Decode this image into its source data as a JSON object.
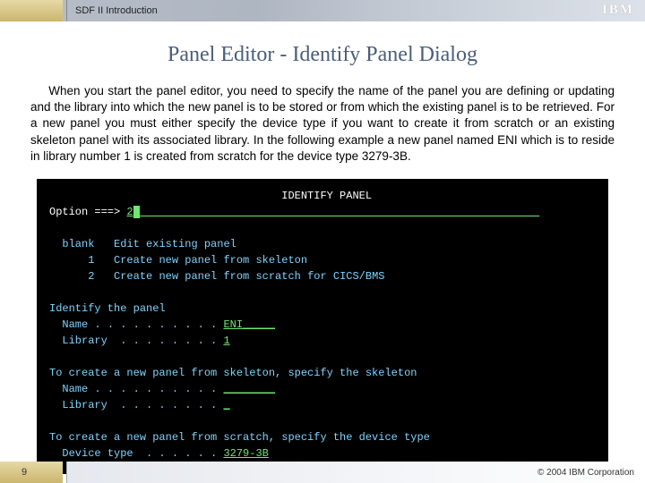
{
  "header": {
    "product": "SDF II  Introduction",
    "logo": "IBM"
  },
  "title": "Panel Editor - Identify Panel Dialog",
  "paragraph": "When you start the panel editor, you need to specify the name of the panel you are defining or updating and the library into which the new panel is to be stored or from which the existing panel is to be retrieved. For a new panel you must either specify the device type if you want to create it from scratch or an existing skeleton panel with its associated library. In the following example a new panel named ENI which is to reside in library number 1 is created from scratch for the  device type 3279-3B.",
  "terminal": {
    "heading": "IDENTIFY PANEL",
    "option_prompt": "Option ===>",
    "option_value": "2",
    "options": {
      "blank": {
        "key": "blank",
        "desc": "Edit existing panel"
      },
      "one": {
        "key": "1",
        "desc": "Create new panel from skeleton"
      },
      "two": {
        "key": "2",
        "desc": "Create new panel from scratch for CICS/BMS"
      }
    },
    "identify": {
      "label": "Identify the panel",
      "name_label": "Name . . . . . . . . . .",
      "name_value": "ENI",
      "name_pad": "_____",
      "lib_label": "Library  . . . . . . . .",
      "lib_value": "1"
    },
    "skeleton": {
      "label": "To create a new panel from skeleton, specify the skeleton",
      "name_label": "Name . . . . . . . . . .",
      "name_blank": "________",
      "lib_label": "Library  . . . . . . . .",
      "lib_blank": "_"
    },
    "scratch": {
      "label": "To create a new panel from scratch, specify the device type",
      "device_label": "Device type  . . . . . .",
      "device_value": "3279-3B"
    }
  },
  "footer": {
    "pageno": "9",
    "copyright": "© 2004 IBM Corporation"
  }
}
